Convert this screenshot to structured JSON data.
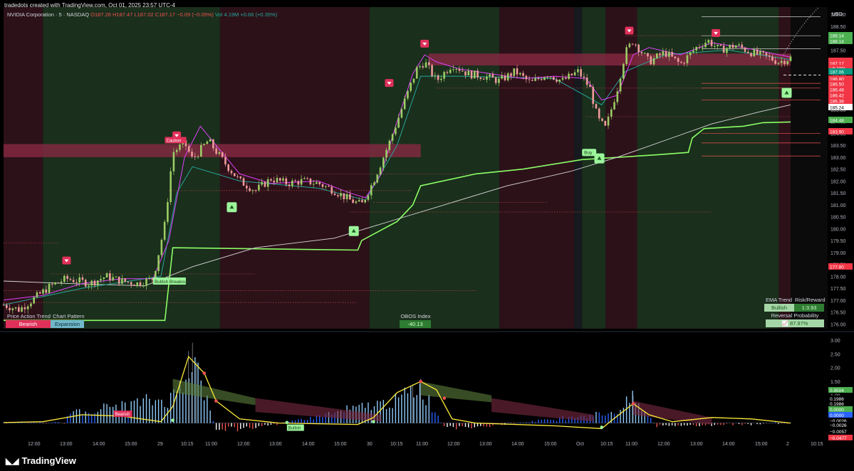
{
  "header": {
    "attribution": "tradedots created with TradingView.com, Oct 01, 2025 23:57 UTC-4"
  },
  "legend": {
    "symbol": "NVIDIA Corporation · 5 · NASDAQ",
    "o": "O187.26",
    "h": "H187.47",
    "l": "L187.02",
    "c": "C187.17",
    "change": "−0.09 (−0.05%)",
    "vol": "Vol 4.19M",
    "vol_change": "+0.66 (+0.35%)"
  },
  "price_axis": {
    "currency": "USD",
    "ticks": [
      "189.00",
      "188.50",
      "188.00",
      "187.50",
      "187.00",
      "186.50",
      "186.00",
      "185.50",
      "185.00",
      "184.50",
      "184.00",
      "183.50",
      "183.00",
      "182.50",
      "182.00",
      "181.50",
      "181.00",
      "180.50",
      "180.00",
      "179.50",
      "179.00",
      "178.50",
      "178.00",
      "177.50",
      "177.00",
      "176.50",
      "176.00"
    ],
    "labels": [
      {
        "text": "188.14",
        "color": "#4caf50"
      },
      {
        "text": "188.14",
        "color": "#4caf50"
      },
      {
        "text": "NVDA",
        "color": "#f23645"
      },
      {
        "text": "187.17",
        "color": "#f23645"
      },
      {
        "text": "+0.18%",
        "color": "#f23645"
      },
      {
        "text": "187.06",
        "color": "#089981"
      },
      {
        "text": "186.80",
        "color": "#f23645"
      },
      {
        "text": "186.50",
        "color": "#f23645"
      },
      {
        "text": "186.48",
        "color": "#f23645"
      },
      {
        "text": "186.42",
        "color": "#f23645"
      },
      {
        "text": "186.38",
        "color": "#f23645"
      },
      {
        "text": "185.24",
        "color": "#000000"
      },
      {
        "text": "184.48",
        "color": "#4caf50"
      },
      {
        "text": "183.90",
        "color": "#f23645"
      },
      {
        "text": "177.80",
        "color": "#f23645"
      }
    ]
  },
  "osc_axis": {
    "ticks": [
      "3.00",
      "2.50",
      "2.00",
      "1.50",
      "1.00",
      "0.50"
    ],
    "labels": [
      {
        "text": "0.9504",
        "color": "#4caf50"
      },
      {
        "text": "0.1986",
        "color": "#ffffff"
      },
      {
        "text": "0.1986",
        "color": "#ffffff"
      },
      {
        "text": "0.0000",
        "color": "#4caf50"
      },
      {
        "text": "0.0000",
        "color": "#2962ff"
      },
      {
        "text": "−0.0026",
        "color": "#ffffff"
      },
      {
        "text": "−0.0026",
        "color": "#ffffff"
      },
      {
        "text": "−0.0057",
        "color": "#ffffff"
      },
      {
        "text": "−0.0477",
        "color": "#f23645"
      }
    ]
  },
  "time_axis": [
    "12:00",
    "13:00",
    "14:00",
    "15:00",
    "29",
    "10:15",
    "11:00",
    "12:00",
    "13:00",
    "14:00",
    "15:00",
    "30",
    "10:15",
    "11:00",
    "12:00",
    "13:00",
    "14:00",
    "15:00",
    "Oct",
    "10:15",
    "11:00",
    "12:00",
    "13:00",
    "14:00",
    "15:00",
    "2",
    "10:15"
  ],
  "panels": {
    "price_action_trend_title": "Price Action Trend",
    "price_action_trend_value": "Bearish",
    "chart_pattern_title": "Chart Pattern",
    "chart_pattern_value": "Expansion",
    "obos_title": "OBOS Index",
    "obos_value": "-40.13",
    "ema_trend_title": "EMA Trend",
    "ema_trend_value": "Bullish",
    "risk_reward_title": "Risk/Reward",
    "risk_reward_value": "1:3.93",
    "reversal_title": "Reversal Probability",
    "reversal_value": "87.97%"
  },
  "annotations": {
    "bullish_breakout": "Bullish Breakout",
    "buy": "Buy",
    "caution": "Caution",
    "osc_bearish": "Bearish",
    "osc_bullish": "Bullish"
  },
  "branding": {
    "logo": "TradingView"
  },
  "colors": {
    "bull_zone": "#1a2f1c",
    "bear_zone": "#2c1119",
    "grey_zone": "#161a1e",
    "supertrend": "#8cff66",
    "fast_ema": "#e040fb",
    "slow_ema": "#26a69a",
    "long_ma": "#d8d8d8",
    "up_candle": "#9ccc65",
    "down_candle": "#ef9a9a"
  },
  "chart_data": {
    "type": "candlestick",
    "symbol": "NVDA",
    "timeframe": "5",
    "ylim": [
      175.8,
      189.3
    ],
    "price_path": [
      [
        0,
        176.8
      ],
      [
        0.02,
        176.6
      ],
      [
        0.04,
        177.1
      ],
      [
        0.06,
        177.6
      ],
      [
        0.08,
        177.9
      ],
      [
        0.11,
        177.7
      ],
      [
        0.13,
        178.0
      ],
      [
        0.15,
        177.8
      ],
      [
        0.17,
        177.7
      ],
      [
        0.19,
        177.9
      ],
      [
        0.205,
        180.2
      ],
      [
        0.215,
        183.2
      ],
      [
        0.23,
        183.6
      ],
      [
        0.24,
        182.9
      ],
      [
        0.25,
        183.3
      ],
      [
        0.26,
        183.7
      ],
      [
        0.28,
        182.8
      ],
      [
        0.3,
        182.0
      ],
      [
        0.32,
        181.6
      ],
      [
        0.34,
        182.1
      ],
      [
        0.36,
        181.9
      ],
      [
        0.38,
        182.0
      ],
      [
        0.4,
        181.9
      ],
      [
        0.42,
        181.6
      ],
      [
        0.44,
        181.2
      ],
      [
        0.455,
        181.0
      ],
      [
        0.47,
        182.0
      ],
      [
        0.49,
        183.6
      ],
      [
        0.51,
        185.4
      ],
      [
        0.525,
        186.7
      ],
      [
        0.535,
        187.0
      ],
      [
        0.55,
        186.2
      ],
      [
        0.57,
        186.9
      ],
      [
        0.59,
        186.5
      ],
      [
        0.61,
        186.4
      ],
      [
        0.63,
        186.2
      ],
      [
        0.65,
        186.6
      ],
      [
        0.67,
        186.1
      ],
      [
        0.69,
        186.5
      ],
      [
        0.71,
        186.2
      ],
      [
        0.73,
        186.6
      ],
      [
        0.745,
        185.9
      ],
      [
        0.755,
        184.6
      ],
      [
        0.765,
        184.2
      ],
      [
        0.78,
        185.9
      ],
      [
        0.79,
        187.4
      ],
      [
        0.8,
        187.9
      ],
      [
        0.82,
        187.0
      ],
      [
        0.84,
        187.4
      ],
      [
        0.86,
        186.9
      ],
      [
        0.88,
        187.6
      ],
      [
        0.895,
        187.9
      ],
      [
        0.91,
        187.5
      ],
      [
        0.93,
        187.7
      ],
      [
        0.95,
        187.4
      ],
      [
        0.97,
        187.2
      ],
      [
        0.985,
        187.0
      ],
      [
        1.0,
        187.17
      ]
    ],
    "supertrend": [
      [
        0,
        176.15
      ],
      [
        0.205,
        176.15
      ],
      [
        0.215,
        179.2
      ],
      [
        0.45,
        179.1
      ],
      [
        0.455,
        179.5
      ],
      [
        0.5,
        180.3
      ],
      [
        0.52,
        181.0
      ],
      [
        0.53,
        181.8
      ],
      [
        0.6,
        182.3
      ],
      [
        0.66,
        182.5
      ],
      [
        0.735,
        182.9
      ],
      [
        0.83,
        183.1
      ],
      [
        0.87,
        183.2
      ],
      [
        0.875,
        183.8
      ],
      [
        0.89,
        184.2
      ],
      [
        0.94,
        184.3
      ],
      [
        0.965,
        184.45
      ],
      [
        1.0,
        184.48
      ]
    ],
    "fast_ema": [
      [
        0,
        177.0
      ],
      [
        0.05,
        177.2
      ],
      [
        0.1,
        177.7
      ],
      [
        0.15,
        177.9
      ],
      [
        0.19,
        177.9
      ],
      [
        0.21,
        179.5
      ],
      [
        0.23,
        183.0
      ],
      [
        0.25,
        184.3
      ],
      [
        0.27,
        183.5
      ],
      [
        0.3,
        182.3
      ],
      [
        0.34,
        181.9
      ],
      [
        0.4,
        182.0
      ],
      [
        0.44,
        181.5
      ],
      [
        0.46,
        181.3
      ],
      [
        0.48,
        182.3
      ],
      [
        0.5,
        184.5
      ],
      [
        0.52,
        186.5
      ],
      [
        0.535,
        187.3
      ],
      [
        0.55,
        187.0
      ],
      [
        0.58,
        186.7
      ],
      [
        0.62,
        186.5
      ],
      [
        0.66,
        186.3
      ],
      [
        0.7,
        186.4
      ],
      [
        0.74,
        186.3
      ],
      [
        0.76,
        185.4
      ],
      [
        0.78,
        185.6
      ],
      [
        0.8,
        187.3
      ],
      [
        0.82,
        187.6
      ],
      [
        0.86,
        187.3
      ],
      [
        0.9,
        187.8
      ],
      [
        0.94,
        187.6
      ],
      [
        1.0,
        187.2
      ]
    ],
    "slow_ema": [
      [
        0,
        176.8
      ],
      [
        0.1,
        177.5
      ],
      [
        0.2,
        178.0
      ],
      [
        0.22,
        181.5
      ],
      [
        0.24,
        182.6
      ],
      [
        0.3,
        182.0
      ],
      [
        0.4,
        181.7
      ],
      [
        0.46,
        181.2
      ],
      [
        0.5,
        183.5
      ],
      [
        0.53,
        186.4
      ],
      [
        0.58,
        186.4
      ],
      [
        0.7,
        186.3
      ],
      [
        0.76,
        185.2
      ],
      [
        0.79,
        186.6
      ],
      [
        0.84,
        187.3
      ],
      [
        0.92,
        187.5
      ],
      [
        1.0,
        187.1
      ]
    ],
    "long_ma": [
      [
        0,
        177.8
      ],
      [
        0.08,
        177.7
      ],
      [
        0.18,
        177.6
      ],
      [
        0.24,
        178.4
      ],
      [
        0.32,
        179.2
      ],
      [
        0.42,
        179.6
      ],
      [
        0.5,
        180.4
      ],
      [
        0.56,
        181.0
      ],
      [
        0.64,
        181.8
      ],
      [
        0.72,
        182.4
      ],
      [
        0.78,
        183.0
      ],
      [
        0.84,
        183.7
      ],
      [
        0.9,
        184.4
      ],
      [
        0.96,
        184.9
      ],
      [
        1.0,
        185.2
      ]
    ],
    "zones": [
      {
        "from": 0,
        "to": 0.05,
        "kind": "bear"
      },
      {
        "from": 0.05,
        "to": 0.275,
        "kind": "bull"
      },
      {
        "from": 0.275,
        "to": 0.465,
        "kind": "bear"
      },
      {
        "from": 0.465,
        "to": 0.63,
        "kind": "bull"
      },
      {
        "from": 0.63,
        "to": 0.725,
        "kind": "bear"
      },
      {
        "from": 0.725,
        "to": 0.735,
        "kind": "grey"
      },
      {
        "from": 0.735,
        "to": 0.765,
        "kind": "bull"
      },
      {
        "from": 0.765,
        "to": 0.805,
        "kind": "bear"
      },
      {
        "from": 0.805,
        "to": 0.985,
        "kind": "bull"
      },
      {
        "from": 0.985,
        "to": 1.0,
        "kind": "bear"
      }
    ],
    "resistance_bands": [
      {
        "from": 0,
        "to": 0.53,
        "y1": 183.0,
        "y2": 183.55
      },
      {
        "from": 0.54,
        "to": 1.0,
        "y1": 186.85,
        "y2": 187.35
      }
    ],
    "signals": [
      {
        "x": 0.08,
        "y": 178.65,
        "kind": "sell"
      },
      {
        "x": 0.22,
        "y": 183.9,
        "kind": "sell"
      },
      {
        "x": 0.29,
        "y": 180.9,
        "kind": "buy"
      },
      {
        "x": 0.445,
        "y": 179.9,
        "kind": "buy"
      },
      {
        "x": 0.49,
        "y": 186.1,
        "kind": "sell"
      },
      {
        "x": 0.535,
        "y": 187.75,
        "kind": "sell"
      },
      {
        "x": 0.757,
        "y": 182.95,
        "kind": "buy"
      },
      {
        "x": 0.795,
        "y": 188.3,
        "kind": "sell"
      },
      {
        "x": 0.905,
        "y": 188.2,
        "kind": "sell"
      },
      {
        "x": 0.995,
        "y": 185.7,
        "kind": "buy"
      }
    ],
    "oscillator": {
      "ylim": [
        -0.6,
        3.2
      ],
      "yellow_line": [
        [
          0,
          0.02
        ],
        [
          0.05,
          0.05
        ],
        [
          0.1,
          0.3
        ],
        [
          0.15,
          0.25
        ],
        [
          0.2,
          0.05
        ],
        [
          0.215,
          0.6
        ],
        [
          0.235,
          2.4
        ],
        [
          0.255,
          1.8
        ],
        [
          0.27,
          0.8
        ],
        [
          0.3,
          0.15
        ],
        [
          0.35,
          0.0
        ],
        [
          0.45,
          -0.05
        ],
        [
          0.47,
          0.2
        ],
        [
          0.5,
          1.1
        ],
        [
          0.53,
          1.5
        ],
        [
          0.55,
          1.2
        ],
        [
          0.57,
          0.15
        ],
        [
          0.6,
          0.0
        ],
        [
          0.7,
          -0.1
        ],
        [
          0.76,
          -0.2
        ],
        [
          0.775,
          0.15
        ],
        [
          0.8,
          0.7
        ],
        [
          0.82,
          0.3
        ],
        [
          0.85,
          0.05
        ],
        [
          0.9,
          0.2
        ],
        [
          0.95,
          0.15
        ],
        [
          1.0,
          0.0
        ]
      ],
      "histogram_peaks": [
        [
          0.08,
          0.4
        ],
        [
          0.215,
          1.1
        ],
        [
          0.24,
          3.0
        ],
        [
          0.27,
          -0.3
        ],
        [
          0.32,
          -0.25
        ],
        [
          0.5,
          1.0
        ],
        [
          0.53,
          1.6
        ],
        [
          0.56,
          -0.2
        ],
        [
          0.62,
          -0.15
        ],
        [
          0.78,
          0.5
        ],
        [
          0.8,
          1.1
        ],
        [
          0.83,
          -0.15
        ],
        [
          0.9,
          -0.1
        ]
      ]
    }
  }
}
